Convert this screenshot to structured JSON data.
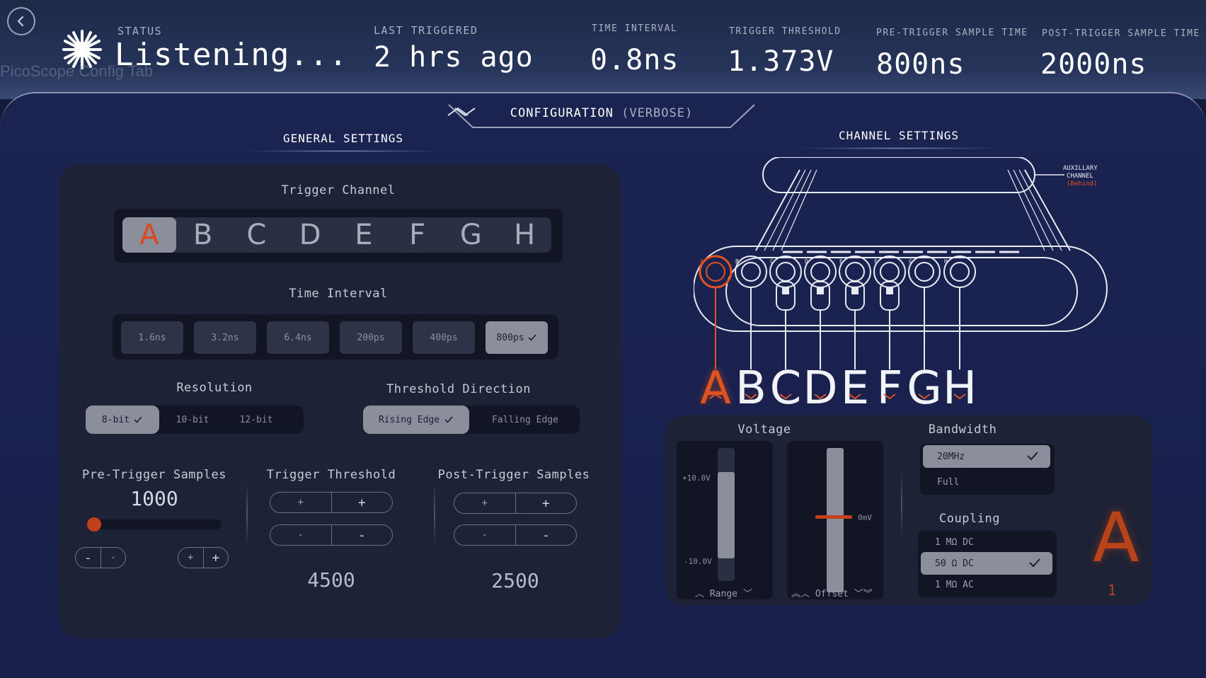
{
  "ghost_tab_label": "PicoScope Config Tab",
  "header": {
    "status_label": "STATUS",
    "status_value": "Listening...",
    "last_triggered_label": "LAST TRIGGERED",
    "last_triggered_value": "2 hrs ago",
    "time_interval_label": "TIME INTERVAL",
    "time_interval_value": "0.8ns",
    "trigger_threshold_label": "TRIGGER THRESHOLD",
    "trigger_threshold_value": "1.373V",
    "pre_trigger_label": "PRE-TRIGGER SAMPLE TIME",
    "pre_trigger_value": "800ns",
    "post_trigger_label": "POST-TRIGGER SAMPLE TIME",
    "post_trigger_value": "2000ns"
  },
  "config_tab": {
    "label": "CONFIGURATION",
    "mode": "(VERBOSE)"
  },
  "general": {
    "title": "GENERAL SETTINGS",
    "trigger_channel_label": "Trigger Channel",
    "channels": [
      "A",
      "B",
      "C",
      "D",
      "E",
      "F",
      "G",
      "H"
    ],
    "selected_channel": "A",
    "time_interval_label": "Time Interval",
    "time_intervals": [
      "1.6ns",
      "3.2ns",
      "6.4ns",
      "200ps",
      "400ps",
      "800ps"
    ],
    "selected_time_interval": "800ps",
    "resolution_label": "Resolution",
    "resolutions": [
      "8-bit",
      "10-bit",
      "12-bit"
    ],
    "selected_resolution": "8-bit",
    "threshold_direction_label": "Threshold Direction",
    "directions": [
      "Rising Edge",
      "Falling Edge"
    ],
    "selected_direction": "Rising Edge",
    "pre_trigger_samples_label": "Pre-Trigger Samples",
    "pre_trigger_samples_value": "1000",
    "pre_trigger_slider_fraction": 0.0,
    "trigger_threshold_label": "Trigger Threshold",
    "trigger_threshold_value": "4500",
    "post_trigger_samples_label": "Post-Trigger Samples",
    "post_trigger_samples_value": "2500",
    "plus": "+",
    "minus": "-"
  },
  "channel_settings": {
    "title": "CHANNEL SETTINGS",
    "aux_label_1": "AUXILLARY",
    "aux_label_2": "CHANNEL",
    "aux_label_3": "(Behind)",
    "channels": [
      "A",
      "B",
      "C",
      "D",
      "E",
      "F",
      "G",
      "H"
    ],
    "selected_channel": "A",
    "selected_channel_index": "1",
    "voltage_label": "Voltage",
    "range_max": "+10.0V",
    "range_min": "-10.0V",
    "range_label": "Range",
    "offset_value": "0mV",
    "offset_label": "Offset",
    "bandwidth_label": "Bandwidth",
    "bandwidth_options": [
      "20MHz",
      "Full"
    ],
    "selected_bandwidth": "20MHz",
    "coupling_label": "Coupling",
    "coupling_options": [
      "1 MΩ DC",
      "50 Ω DC",
      "1 MΩ AC"
    ],
    "selected_coupling": "50 Ω DC"
  },
  "colors": {
    "accent": "#e0521f",
    "panel": "#1e2236",
    "well": "#121524",
    "selected": "#8b8f9c"
  }
}
